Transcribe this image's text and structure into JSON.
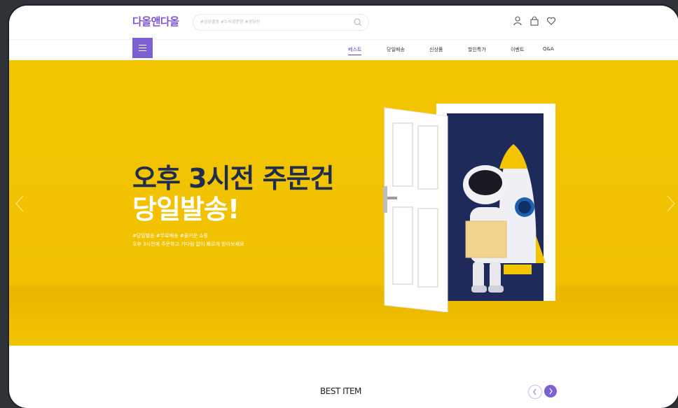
{
  "header": {
    "logo": "다올앤다올",
    "search_placeholder": "#상당출동 #누사업분양 #상당산"
  },
  "nav": {
    "items": [
      {
        "label": "베스트",
        "active": true
      },
      {
        "label": "당일배송",
        "active": false
      },
      {
        "label": "신상품",
        "active": false
      },
      {
        "label": "할인특가",
        "active": false
      },
      {
        "label": "이벤트",
        "active": false
      },
      {
        "label": "Q&A",
        "active": false
      }
    ]
  },
  "hero": {
    "title_line1": "오후 3시전 주문건",
    "title_line2": "당일발송!",
    "sub_line1": "#당일발송 #무료배송 #즐거운 쇼핑",
    "sub_line2": "오후 3시전에 주문하고 기다림 없이 빠르게 받아보세요"
  },
  "best": {
    "title": "BEST ITEM"
  },
  "colors": {
    "accent": "#7d60d2",
    "hero_bg": "#f3c500",
    "title_dark": "#1f2d4f"
  }
}
